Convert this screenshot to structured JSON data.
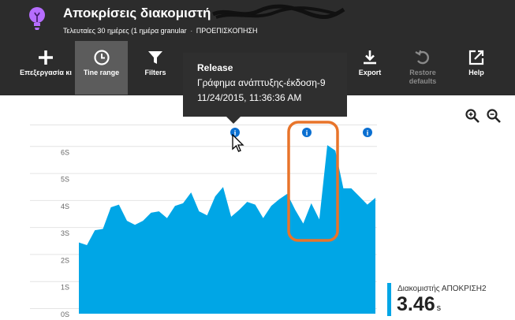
{
  "header": {
    "title": "Αποκρίσεις διακομιστή",
    "subtitle_range": "Τελευταίες 30 ημέρες (1 ημέρα granular",
    "subtitle_separator": "·",
    "subtitle_view": "ΠΡΟΕΠΙΣΚΟΠΗΣΗ",
    "icon": "lightbulb-icon"
  },
  "toolbar": {
    "edit_label": "Επεξεργασία κι",
    "time_range_label_1": "Tine",
    "time_range_label_2": "range",
    "filters_label": "Filters",
    "export_label": "Export",
    "restore_label": "Restore defaults",
    "help_label": "Help"
  },
  "tooltip": {
    "title": "Release",
    "line1": "Γράφημα ανάπτυξης-έκδοση-9",
    "line2": "11/24/2015, 11:36:36 AM"
  },
  "legend": {
    "name": "Διακομιστής ΑΠΟΚΡΙΣΗ2",
    "value": "3.46",
    "unit": "s"
  },
  "colors": {
    "area_fill": "#00a6e6",
    "marker": "#0a6fd1",
    "highlight": "#e8742a",
    "header_bg": "#2c2c2c"
  },
  "chart_data": {
    "type": "area",
    "title": "",
    "xlabel": "",
    "ylabel": "",
    "y_tick_labels": [
      "0S",
      "1S",
      "2S",
      "3S",
      "4S",
      "5S",
      "6S"
    ],
    "ylim": [
      0,
      7
    ],
    "grid": true,
    "series": [
      {
        "name": "Διακομιστής ΑΠΟΚΡΙΣΗ2",
        "values": [
          2.55,
          2.45,
          3.0,
          3.05,
          3.85,
          3.95,
          3.35,
          3.2,
          3.35,
          3.65,
          3.7,
          3.45,
          3.9,
          4.0,
          4.4,
          3.7,
          3.55,
          4.25,
          4.6,
          3.5,
          3.75,
          4.05,
          3.95,
          3.45,
          3.9,
          4.15,
          4.35,
          3.75,
          3.25,
          4.0,
          3.4,
          6.15,
          5.95,
          4.55,
          4.55,
          4.25,
          3.95,
          4.2
        ]
      }
    ],
    "annotations": [
      {
        "type": "release",
        "label": "i"
      },
      {
        "type": "release",
        "label": "i"
      },
      {
        "type": "release",
        "label": "i"
      }
    ]
  }
}
